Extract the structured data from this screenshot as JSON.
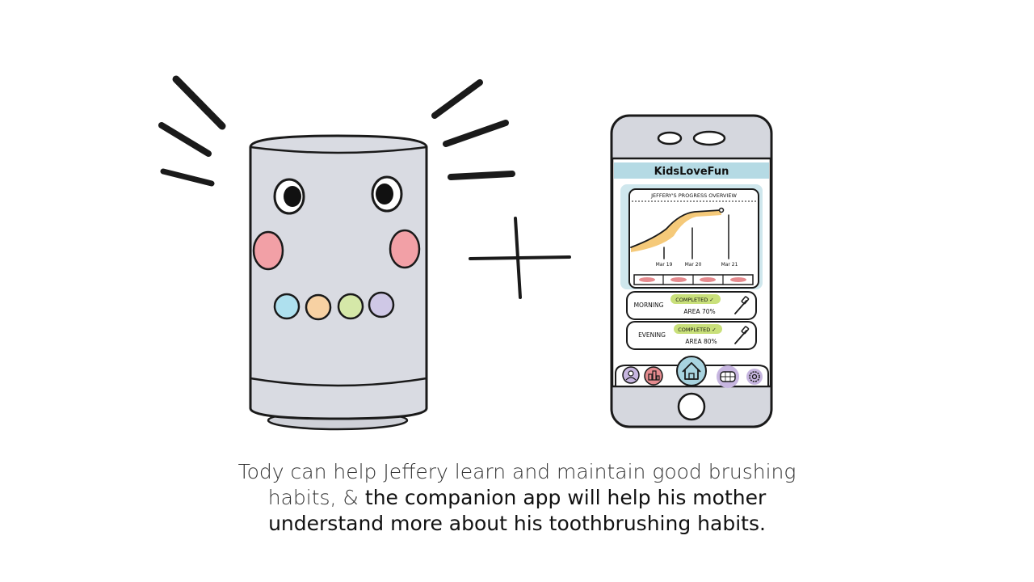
{
  "colors": {
    "speaker_body": "#d9dbe2",
    "cheek": "#f2a0a6",
    "led_blue": "#aee0ee",
    "led_orange": "#f7d1a3",
    "led_green": "#d5e8a8",
    "led_purple": "#cfc8e6",
    "phone_accent": "#a8d3df",
    "chart_line": "#f4c36a",
    "completed_highlight": "#c9e07a",
    "nav_purple": "#c7b6e0",
    "nav_red": "#e58b8f"
  },
  "phone": {
    "app_name": "KidsLoveFun",
    "chart_title": "JEFFERY'S PROGRESS OVERVIEW",
    "chart_dates": [
      "Mar 19",
      "Mar 20",
      "Mar 21"
    ],
    "sessions": [
      {
        "name": "MORNING",
        "status": "COMPLETED ✓",
        "area": "AREA 70%"
      },
      {
        "name": "EVENING",
        "status": "COMPLETED ✓",
        "area": "AREA 80%"
      }
    ],
    "nav_icons": [
      "profile-icon",
      "stats-icon",
      "home-icon",
      "teeth-icon",
      "settings-icon"
    ]
  },
  "caption": {
    "light": "Tody can help Jeffery learn and maintain good brushing habits, & ",
    "bold": "the companion app will help his mother understand more about his toothbrushing habits."
  }
}
